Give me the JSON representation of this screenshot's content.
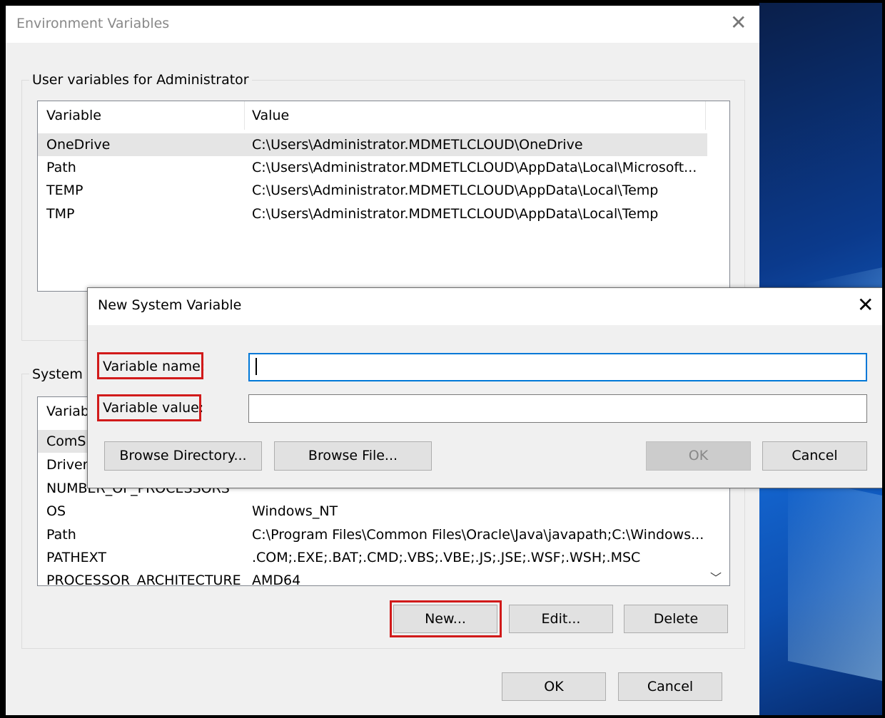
{
  "window": {
    "title": "Environment Variables"
  },
  "user_section": {
    "label": "User variables for Administrator",
    "headers": [
      "Variable",
      "Value"
    ],
    "rows": [
      {
        "name": "OneDrive",
        "value": "C:\\Users\\Administrator.MDMETLCLOUD\\OneDrive"
      },
      {
        "name": "Path",
        "value": "C:\\Users\\Administrator.MDMETLCLOUD\\AppData\\Local\\Microsoft..."
      },
      {
        "name": "TEMP",
        "value": "C:\\Users\\Administrator.MDMETLCLOUD\\AppData\\Local\\Temp"
      },
      {
        "name": "TMP",
        "value": "C:\\Users\\Administrator.MDMETLCLOUD\\AppData\\Local\\Temp"
      }
    ]
  },
  "system_section": {
    "label": "System v",
    "headers": [
      "Variabl"
    ],
    "rows": [
      {
        "name": "ComS",
        "value": ""
      },
      {
        "name": "Driver",
        "value": ""
      },
      {
        "name": "NUMBER_OF_PROCESSORS",
        "value": ""
      },
      {
        "name": "OS",
        "value": "Windows_NT"
      },
      {
        "name": "Path",
        "value": "C:\\Program Files\\Common Files\\Oracle\\Java\\javapath;C:\\Windows..."
      },
      {
        "name": "PATHEXT",
        "value": ".COM;.EXE;.BAT;.CMD;.VBS;.VBE;.JS;.JSE;.WSF;.WSH;.MSC"
      },
      {
        "name": "PROCESSOR_ARCHITECTURE",
        "value": "AMD64"
      }
    ],
    "buttons": {
      "new": "New...",
      "edit": "Edit...",
      "delete": "Delete"
    }
  },
  "footer": {
    "ok": "OK",
    "cancel": "Cancel"
  },
  "dialog": {
    "title": "New System Variable",
    "name_label": "Variable name:",
    "value_label": "Variable value:",
    "name_value": "",
    "value_value": "",
    "browse_dir": "Browse Directory...",
    "browse_file": "Browse File...",
    "ok": "OK",
    "cancel": "Cancel"
  },
  "icons": {
    "close": "close-icon",
    "scroll": "chevron-down-icon"
  },
  "colors": {
    "highlight": "#d11a1a",
    "focus": "#0078d7"
  }
}
